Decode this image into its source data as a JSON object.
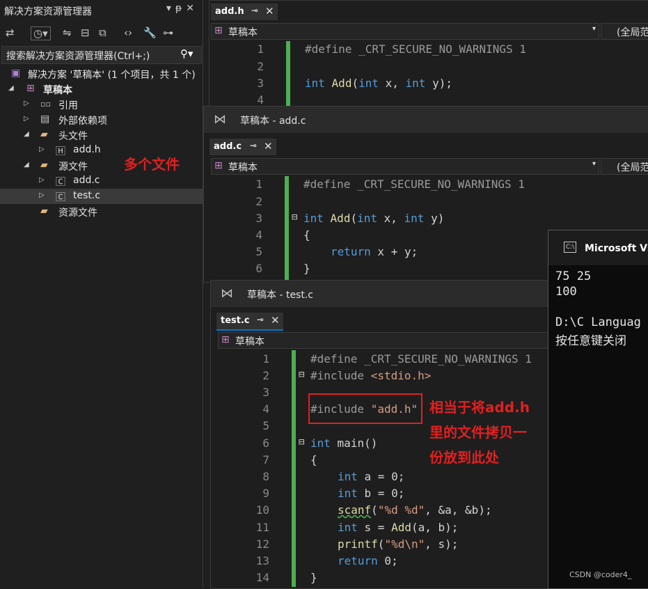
{
  "solution_explorer": {
    "title": "解决方案资源管理器",
    "title_controls": "▾ ᵽ ✕",
    "search_placeholder": "搜索解决方案资源管理器(Ctrl+;)",
    "solution_label": "解决方案 '草稿本' (1 个项目，共 1 个)",
    "project_label": "草稿本",
    "items": [
      {
        "label": "引用"
      },
      {
        "label": "外部依赖项"
      },
      {
        "label": "头文件"
      },
      {
        "label": "add.h"
      },
      {
        "label": "源文件"
      },
      {
        "label": "add.c"
      },
      {
        "label": "test.c"
      },
      {
        "label": "资源文件"
      }
    ],
    "annotation": "多个文件"
  },
  "editor_addh": {
    "tab_name": "add.h",
    "nav_project": "草稿本",
    "nav_scope": "(全局范",
    "lines": [
      "1",
      "2",
      "3",
      "4"
    ],
    "code": {
      "l1_pp": "#define _CRT_SECURE_NO_WARNINGS 1",
      "l3_kw1": "int",
      "l3_fn": "Add",
      "l3_p1": "(",
      "l3_kw2": "int",
      "l3_p2": " x, ",
      "l3_kw3": "int",
      "l3_p3": " y);"
    }
  },
  "editor_addc": {
    "window_title": "草稿本 - add.c",
    "tab_name": "add.c",
    "nav_project": "草稿本",
    "nav_scope": "(全局范",
    "lines": [
      "1",
      "2",
      "3",
      "4",
      "5",
      "6"
    ],
    "code": {
      "l1_pp": "#define _CRT_SECURE_NO_WARNINGS 1",
      "l3_kw1": "int",
      "l3_fn": "Add",
      "l3_p1": "(",
      "l3_kw2": "int",
      "l3_p2": " x, ",
      "l3_kw3": "int",
      "l3_p3": " y)",
      "l4": "{",
      "l5_kw": "return",
      "l5_rest": " x + y;",
      "l6": "}"
    }
  },
  "editor_testc": {
    "window_title": "草稿本 - test.c",
    "tab_name": "test.c",
    "nav_project": "草稿本",
    "lines": [
      "1",
      "2",
      "3",
      "4",
      "5",
      "6",
      "7",
      "8",
      "9",
      "10",
      "11",
      "12",
      "13",
      "14"
    ],
    "code": {
      "l1_pp": "#define _CRT_SECURE_NO_WARNINGS 1",
      "l2_pp": "#include ",
      "l2_st": "<stdio.h>",
      "l4_pp": "#include ",
      "l4_st": "\"add.h\"",
      "l6_kw": "int",
      "l6_fn": " main",
      "l6_rest": "()",
      "l7": "{",
      "l8_kw": "int",
      "l8_rest": " a = 0;",
      "l9_kw": "int",
      "l9_rest": " b = 0;",
      "l10_fn": "scanf",
      "l10_p1": "(",
      "l10_st": "\"%d %d\"",
      "l10_rest": ", &a, &b);",
      "l11_kw": "int",
      "l11_mid": " s = ",
      "l11_fn": "Add",
      "l11_rest": "(a, b);",
      "l12_fn": "printf",
      "l12_p1": "(",
      "l12_st": "\"%d\\n\"",
      "l12_rest": ", s);",
      "l13_kw": "return",
      "l13_rest": " 0;",
      "l14": "}"
    },
    "annotation_lines": [
      "相当于将add.h",
      "里的文件拷贝一",
      "份放到此处"
    ]
  },
  "console": {
    "title": "Microsoft Vis",
    "lines": [
      "75 25",
      "100",
      "",
      "D:\\C Languag",
      "按任意键关闭"
    ]
  },
  "watermark": "CSDN @coder4_"
}
